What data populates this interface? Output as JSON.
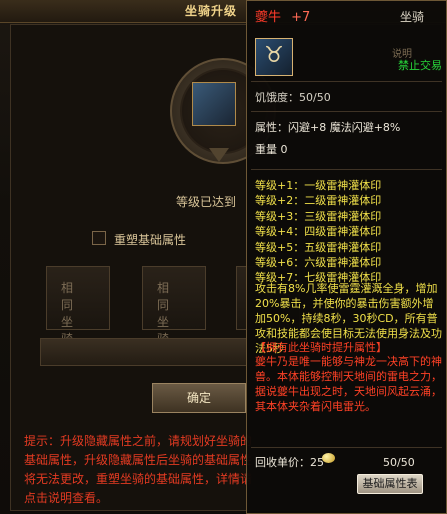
{
  "background_window": {
    "title": "坐骑升级",
    "level_text": "等级已达到",
    "reset_label": "重塑基础属性",
    "slot_label": "相同坐骑",
    "confirm_label": "确定",
    "hint": "提示：升级隐藏属性之前，请规划好坐骑的基础属性，升级隐藏属性后坐骑的基础属性将无法更改，重塑坐骑的基础属性，详情请点击说明查看。"
  },
  "tooltip": {
    "name": "夔牛",
    "enhance": "+7",
    "type": "坐骑",
    "icon": "ox-mount-icon",
    "explain_label": "说明",
    "trade_status": "禁止交易",
    "hunger": "饥饿度：50/50",
    "attributes": "属性：闪避+8   魔法闪避+8%",
    "weight": "重量 0",
    "skills": [
      "等级+1：一级雷神灌体印",
      "等级+2：二级雷神灌体印",
      "等级+3：三级雷神灌体印",
      "等级+4：四级雷神灌体印",
      "等级+5：五级雷神灌体印",
      "等级+6：六级雷神灌体印",
      "等级+7：七级雷神灌体印"
    ],
    "skill_desc": "攻击有8%几率使雷霆灌溉全身，增加20%暴击，并使你的暴击伤害额外增加50%，持续8秒，30秒CD，所有普攻和技能都会使目标无法使用身法及功法5秒",
    "unique_title": "【拥有此坐骑时提升属性】",
    "unique_desc": "夔牛乃是唯一能够与神龙一决高下的神兽。本体能够控制天地间的雷电之力，据说夔牛出现之时，天地间风起云涌，其本体夹杂着闪电雷光。",
    "price_label": "回收单价：25",
    "count": "50/50",
    "attr_button": "基础属性表"
  },
  "colors": {
    "accent_gold": "#d7b272",
    "name_red": "#ff3b2a",
    "skill_yellow": "#f0e04a",
    "trade_green": "#27d63a"
  }
}
